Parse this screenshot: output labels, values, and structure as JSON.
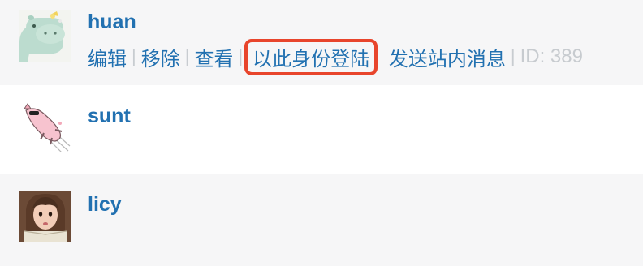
{
  "users": [
    {
      "name": "huan",
      "avatar": "hippo-avatar",
      "actions": [
        {
          "label": "编辑",
          "highlighted": false
        },
        {
          "label": "移除",
          "highlighted": false
        },
        {
          "label": "查看",
          "highlighted": false
        },
        {
          "label": "以此身份登陆",
          "highlighted": true
        },
        {
          "label": "发送站内消息",
          "highlighted": false
        }
      ],
      "id_text": "ID: 389"
    },
    {
      "name": "sunt",
      "avatar": "pig-avatar"
    },
    {
      "name": "licy",
      "avatar": "girl-photo-avatar"
    }
  ],
  "colors": {
    "link": "#2271b1",
    "separator": "#c8ccd0",
    "id_text": "#c7cbcf",
    "highlight_border": "#e8452c",
    "row_alt": "#f6f6f7"
  },
  "separator_glyph": "|"
}
